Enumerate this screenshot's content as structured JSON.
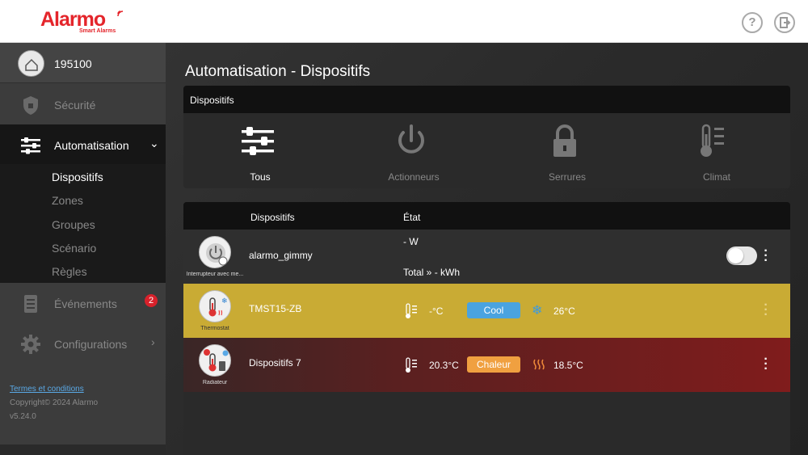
{
  "brand": {
    "name": "Alarmo",
    "tagline": "Smart Alarms",
    "accent": "#e4252b"
  },
  "header": {
    "help_icon": "question-icon",
    "logout_icon": "logout-icon",
    "help_label": "?"
  },
  "sidebar": {
    "user": {
      "name": "195100"
    },
    "nav": [
      {
        "label": "Sécurité",
        "icon": "shield-icon"
      },
      {
        "label": "Automatisation",
        "icon": "sliders-icon"
      },
      {
        "label": "Événements",
        "icon": "list-icon",
        "badge": "2"
      },
      {
        "label": "Configurations",
        "icon": "gear-icon"
      }
    ],
    "submenu": [
      "Dispositifs",
      "Zones",
      "Groupes",
      "Scénario",
      "Règles"
    ],
    "footer": {
      "terms": "Termes et conditions",
      "copyright": "Copyright© 2024 Alarmo",
      "version": "v5.24.0"
    }
  },
  "main": {
    "title": "Automatisation - Dispositifs",
    "categories_title": "Dispositifs",
    "categories": [
      {
        "label": "Tous",
        "icon": "sliders-icon"
      },
      {
        "label": "Actionneurs",
        "icon": "power-icon"
      },
      {
        "label": "Serrures",
        "icon": "lock-icon"
      },
      {
        "label": "Climat",
        "icon": "thermometer-icon"
      }
    ],
    "table": {
      "headers": [
        "Dispositifs",
        "État"
      ],
      "rows": [
        {
          "type": "Interrupteur avec me...",
          "name": "alarmo_gimmy",
          "power": "- W",
          "total": "Total » - kWh"
        },
        {
          "type": "Thermostat",
          "name": "TMST15-ZB",
          "current": "-°C",
          "mode": "Cool",
          "target": "26°C"
        },
        {
          "type": "Radiateur",
          "name": "Dispositifs 7",
          "current": "20.3°C",
          "mode": "Chaleur",
          "target": "18.5°C"
        }
      ]
    }
  }
}
